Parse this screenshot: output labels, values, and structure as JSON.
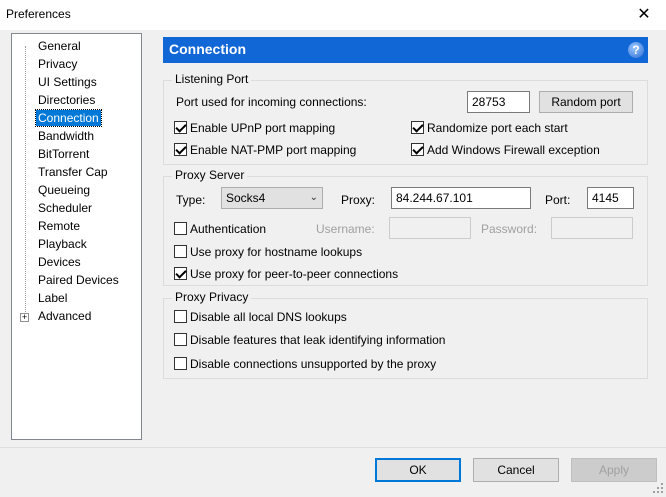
{
  "window": {
    "title": "Preferences"
  },
  "tree": {
    "items": [
      {
        "label": "General"
      },
      {
        "label": "Privacy"
      },
      {
        "label": "UI Settings"
      },
      {
        "label": "Directories"
      },
      {
        "label": "Connection"
      },
      {
        "label": "Bandwidth"
      },
      {
        "label": "BitTorrent"
      },
      {
        "label": "Transfer Cap"
      },
      {
        "label": "Queueing"
      },
      {
        "label": "Scheduler"
      },
      {
        "label": "Remote"
      },
      {
        "label": "Playback"
      },
      {
        "label": "Devices"
      },
      {
        "label": "Paired Devices"
      },
      {
        "label": "Label"
      },
      {
        "label": "Advanced"
      }
    ],
    "selected": "Connection"
  },
  "header": {
    "title": "Connection",
    "help": "?"
  },
  "listening": {
    "label": "Listening Port",
    "port_label": "Port used for incoming connections:",
    "port_value": "28753",
    "random_button": "Random port",
    "upnp": {
      "label": "Enable UPnP port mapping",
      "checked": true
    },
    "natpmp": {
      "label": "Enable NAT-PMP port mapping",
      "checked": true
    },
    "randomize": {
      "label": "Randomize port each start",
      "checked": true
    },
    "firewall": {
      "label": "Add Windows Firewall exception",
      "checked": true
    }
  },
  "proxy": {
    "label": "Proxy Server",
    "type_label": "Type:",
    "type_value": "Socks4",
    "proxy_label": "Proxy:",
    "proxy_value": "84.244.67.101",
    "port_label": "Port:",
    "port_value": "4145",
    "auth": {
      "label": "Authentication",
      "checked": false
    },
    "username_label": "Username:",
    "password_label": "Password:",
    "hostname": {
      "label": "Use proxy for hostname lookups",
      "checked": false
    },
    "p2p": {
      "label": "Use proxy for peer-to-peer connections",
      "checked": true
    }
  },
  "privacy": {
    "label": "Proxy Privacy",
    "dns": {
      "label": "Disable all local DNS lookups",
      "checked": false
    },
    "leak": {
      "label": "Disable features that leak identifying information",
      "checked": false
    },
    "unsupported": {
      "label": "Disable connections unsupported by the proxy",
      "checked": false
    }
  },
  "footer": {
    "ok": "OK",
    "cancel": "Cancel",
    "apply": "Apply"
  },
  "colors": {
    "accent": "#1167d5",
    "selection": "#0078d7"
  }
}
